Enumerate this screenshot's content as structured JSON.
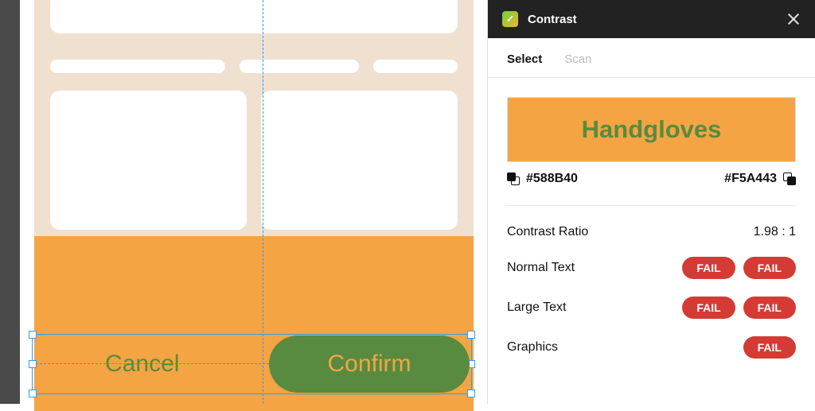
{
  "canvas": {
    "cancel_label": "Cancel",
    "confirm_label": "Confirm"
  },
  "panel": {
    "title": "Contrast",
    "tabs": {
      "select": "Select",
      "scan": "Scan"
    },
    "preview_text": "Handgloves",
    "foreground_hex": "#588B40",
    "background_hex": "#F5A443",
    "ratio_label": "Contrast Ratio",
    "ratio_value": "1.98 : 1",
    "rows": {
      "normal": {
        "label": "Normal Text",
        "badge1": "FAIL",
        "badge2": "FAIL"
      },
      "large": {
        "label": "Large Text",
        "badge1": "FAIL",
        "badge2": "FAIL"
      },
      "graphics": {
        "label": "Graphics",
        "badge1": "FAIL"
      }
    }
  }
}
